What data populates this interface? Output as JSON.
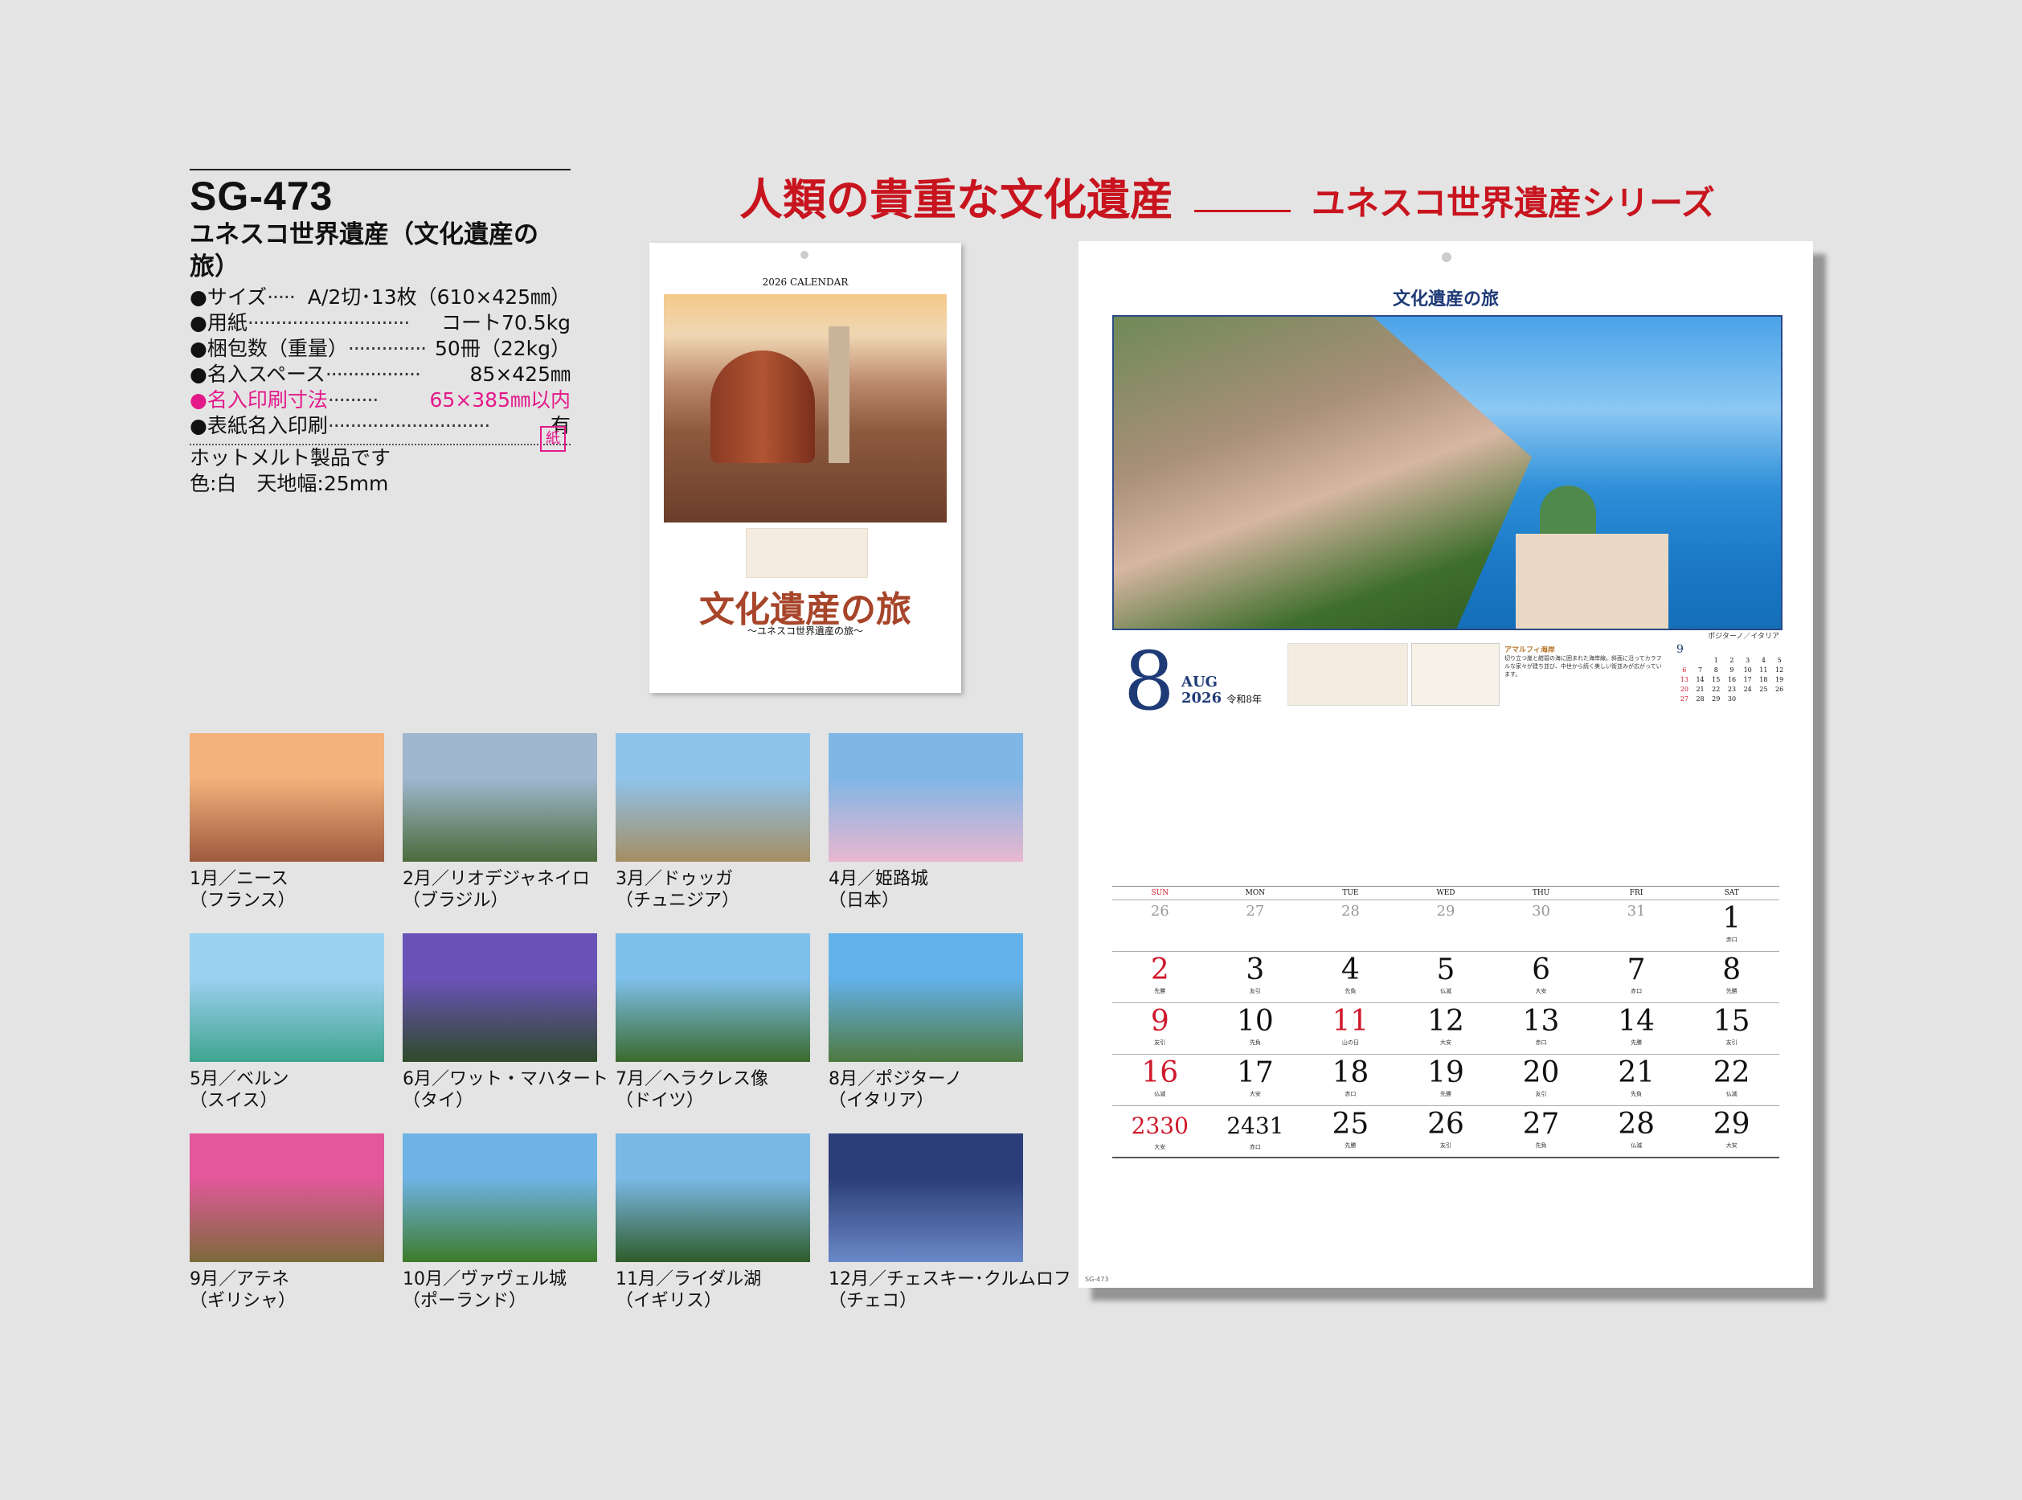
{
  "headline": {
    "main": "人類の貴重な文化遺産",
    "sub": "ユネスコ世界遺産シリーズ"
  },
  "product": {
    "code": "SG-473",
    "name": "ユネスコ世界遺産（文化遺産の旅）",
    "specs": [
      {
        "label": "●サイズ",
        "dots": "·····",
        "value": "A/2切･13枚（610×425㎜）",
        "highlight": false
      },
      {
        "label": "●用紙",
        "dots": "·····························",
        "value": "コート70.5kg",
        "highlight": false
      },
      {
        "label": "●梱包数（重量）",
        "dots": "··············",
        "value": "50冊（22kg）",
        "highlight": false
      },
      {
        "label": "●名入スペース",
        "dots": "·················",
        "value": "85×425㎜",
        "highlight": false
      },
      {
        "label": "●名入印刷寸法",
        "dots": "·········",
        "value": "65×385㎜以内",
        "highlight": true
      },
      {
        "label": "●表紙名入印刷",
        "dots": "·····························",
        "value": "有",
        "highlight": false
      }
    ],
    "notes": [
      "ホットメルト製品です",
      "色:白　天地幅:25mm"
    ],
    "badge": "紙"
  },
  "cover": {
    "calendar_label": "2026 CALENDAR",
    "title": "文化遺産の旅",
    "subtitle": "〜ユネスコ世界遺産の旅〜"
  },
  "thumbnails": [
    {
      "line1": "1月／ニース",
      "line2": "（フランス）",
      "c1": "#f3b27c",
      "c2": "#9d5a3e"
    },
    {
      "line1": "2月／リオデジャネイロ",
      "line2": "（ブラジル）",
      "c1": "#9fb7cf",
      "c2": "#4c6b3b"
    },
    {
      "line1": "3月／ドゥッガ",
      "line2": "（チュニジア）",
      "c1": "#8fc3ea",
      "c2": "#a58e62"
    },
    {
      "line1": "4月／姫路城",
      "line2": "（日本）",
      "c1": "#7fb6e6",
      "c2": "#e9b7cf"
    },
    {
      "line1": "5月／ベルン",
      "line2": "（スイス）",
      "c1": "#9cd0ef",
      "c2": "#3fa58f"
    },
    {
      "line1": "6月／ワット・マハタート",
      "line2": "（タイ）",
      "c1": "#6a53b8",
      "c2": "#2f4a2a"
    },
    {
      "line1": "7月／ヘラクレス像",
      "line2": "（ドイツ）",
      "c1": "#7fc0ea",
      "c2": "#3a6a2c"
    },
    {
      "line1": "8月／ポジターノ",
      "line2": "（イタリア）",
      "c1": "#63b1ea",
      "c2": "#4f7a3f"
    },
    {
      "line1": "9月／アテネ",
      "line2": "（ギリシャ）",
      "c1": "#e2589b",
      "c2": "#7d6a3a"
    },
    {
      "line1": "10月／ヴァヴェル城",
      "line2": "（ポーランド）",
      "c1": "#6fb3e4",
      "c2": "#3e7b2b"
    },
    {
      "line1": "11月／ライダル湖",
      "line2": "（イギリス）",
      "c1": "#7ab8e6",
      "c2": "#2f5c2a"
    },
    {
      "line1": "12月／チェスキー･クルムロフ",
      "line2": "（チェコ）",
      "c1": "#2c3e7a",
      "c2": "#6a88c6"
    }
  ],
  "calendar": {
    "title": "文化遺産の旅",
    "photo_caption": "ポジターノ／イタリア",
    "month_number": "8",
    "month_name": "AUG",
    "year": "2026",
    "era": "令和8年",
    "desc_heading": "アマルフィ海岸",
    "desc_text": "切り立つ崖と紺碧の海に囲まれた海岸線。斜面に沿ってカラフルな家々が建ち並び、中世から続く美しい街並みが広がっています。",
    "footer": "SG-473",
    "mini": {
      "month": "9",
      "rows": [
        [
          "",
          "",
          "1",
          "2",
          "3",
          "4",
          "5"
        ],
        [
          "6",
          "7",
          "8",
          "9",
          "10",
          "11",
          "12"
        ],
        [
          "13",
          "14",
          "15",
          "16",
          "17",
          "18",
          "19"
        ],
        [
          "20",
          "21",
          "22",
          "23",
          "24",
          "25",
          "26"
        ],
        [
          "27",
          "28",
          "29",
          "30",
          "",
          "",
          ""
        ]
      ]
    },
    "weekdays": [
      "SUN",
      "MON",
      "TUE",
      "WED",
      "THU",
      "FRI",
      "SAT"
    ],
    "weeks": [
      [
        {
          "d": "26",
          "prev": true
        },
        {
          "d": "27",
          "prev": true
        },
        {
          "d": "28",
          "prev": true
        },
        {
          "d": "29",
          "prev": true
        },
        {
          "d": "30",
          "prev": true
        },
        {
          "d": "31",
          "prev": true
        },
        {
          "d": "1",
          "s": "赤口"
        }
      ],
      [
        {
          "d": "2",
          "s": "先勝",
          "red": true
        },
        {
          "d": "3",
          "s": "友引"
        },
        {
          "d": "4",
          "s": "先負"
        },
        {
          "d": "5",
          "s": "仏滅"
        },
        {
          "d": "6",
          "s": "大安"
        },
        {
          "d": "7",
          "s": "赤口"
        },
        {
          "d": "8",
          "s": "先勝"
        }
      ],
      [
        {
          "d": "9",
          "s": "友引",
          "red": true
        },
        {
          "d": "10",
          "s": "先負"
        },
        {
          "d": "11",
          "s": "山の日",
          "red": true
        },
        {
          "d": "12",
          "s": "大安"
        },
        {
          "d": "13",
          "s": "赤口"
        },
        {
          "d": "14",
          "s": "先勝"
        },
        {
          "d": "15",
          "s": "友引"
        }
      ],
      [
        {
          "d": "16",
          "s": "仏滅",
          "red": true
        },
        {
          "d": "17",
          "s": "大安"
        },
        {
          "d": "18",
          "s": "赤口"
        },
        {
          "d": "19",
          "s": "先勝"
        },
        {
          "d": "20",
          "s": "友引"
        },
        {
          "d": "21",
          "s": "先負"
        },
        {
          "d": "22",
          "s": "仏滅"
        }
      ],
      [
        {
          "d": "23",
          "d2": "30",
          "s": "大安",
          "red": true
        },
        {
          "d": "24",
          "d2": "31",
          "s": "赤口"
        },
        {
          "d": "25",
          "s": "先勝"
        },
        {
          "d": "26",
          "s": "友引"
        },
        {
          "d": "27",
          "s": "先負"
        },
        {
          "d": "28",
          "s": "仏滅"
        },
        {
          "d": "29",
          "s": "大安"
        }
      ]
    ]
  }
}
